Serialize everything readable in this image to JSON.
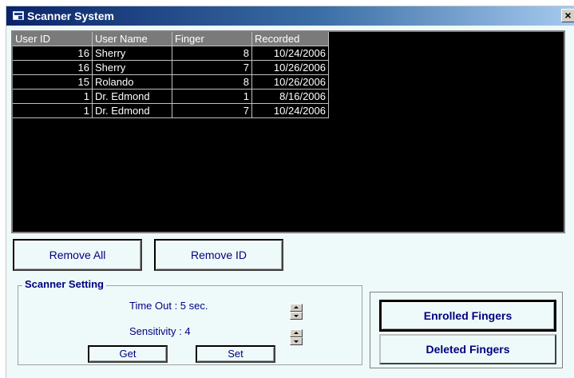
{
  "window": {
    "title": "Scanner System",
    "close_label": "×"
  },
  "table": {
    "columns": [
      "User ID",
      "User Name",
      "Finger",
      "Recorded"
    ],
    "rows": [
      {
        "user_id": "16",
        "user_name": "Sherry",
        "finger": "8",
        "recorded": "10/24/2006"
      },
      {
        "user_id": "16",
        "user_name": "Sherry",
        "finger": "7",
        "recorded": "10/26/2006"
      },
      {
        "user_id": "15",
        "user_name": "Rolando",
        "finger": "8",
        "recorded": "10/26/2006"
      },
      {
        "user_id": "1",
        "user_name": "Dr. Edmond",
        "finger": "1",
        "recorded": "8/16/2006"
      },
      {
        "user_id": "1",
        "user_name": "Dr. Edmond",
        "finger": "7",
        "recorded": "10/24/2006"
      }
    ]
  },
  "buttons": {
    "remove_all": "Remove All",
    "remove_id": "Remove ID",
    "get": "Get",
    "set": "Set",
    "enrolled_fingers": "Enrolled Fingers",
    "deleted_fingers": "Deleted Fingers"
  },
  "scanner_setting": {
    "label": "Scanner Setting",
    "timeout": "Time Out : 5 sec.",
    "sensitivity": "Sensitivity : 4"
  },
  "icons": {
    "window_icon": "scanner-window-icon",
    "spinner": "spin-up-down-icon"
  },
  "colors": {
    "title_gradient_start": "#0a246a",
    "title_gradient_end": "#a6caf0",
    "window_bg": "#eefaf9",
    "grid_bg": "#000000",
    "grid_header_bg": "#7a7a7a",
    "label_text": "#000080"
  }
}
